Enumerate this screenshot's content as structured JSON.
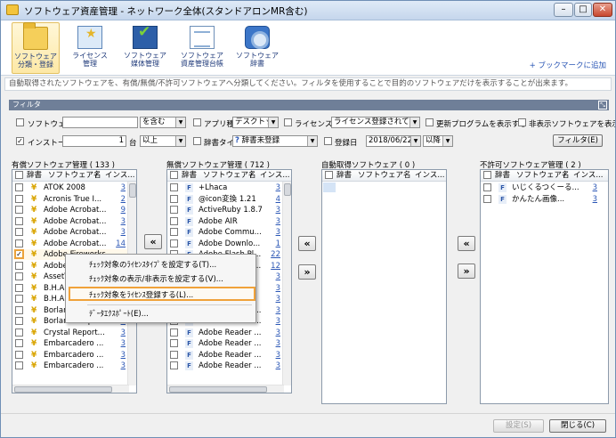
{
  "window": {
    "title": "ソフトウェア資産管理 - ネットワーク全体(スタンドアロンMR含む)",
    "controls": {
      "minimize": "–",
      "maximize": "□",
      "close": "✕"
    }
  },
  "ribbon": {
    "buttons": [
      {
        "label1": "ソフトウェア",
        "label2": "分類・登録",
        "icon": "folder-icon",
        "active": true
      },
      {
        "label1": "ライセンス",
        "label2": "管理",
        "icon": "certificate-icon"
      },
      {
        "label1": "ソフトウェア",
        "label2": "媒体管理",
        "icon": "media-check-icon"
      },
      {
        "label1": "ソフトウェア",
        "label2": "資産管理台帳",
        "icon": "ledger-icon"
      },
      {
        "label1": "ソフトウェア",
        "label2": "辞書",
        "icon": "dictionary-icon"
      }
    ],
    "bookmark": "+ ブックマークに追加"
  },
  "info_text": "自動取得されたソフトウェアを、有償/無償/不許可ソフトウェアへ分類してください。フィルタを使用することで目的のソフトウェアだけを表示することが出来ます。",
  "filter": {
    "header": "フィルタ",
    "corner": "⤡",
    "software_name": {
      "label": "ソフトウェア名",
      "value": "",
      "match": "を含む"
    },
    "app_type": {
      "label": "アプリ種別",
      "value": "デスクトップ"
    },
    "license": {
      "label": "ライセンス登録",
      "value": "ライセンス登録されていない"
    },
    "show_update": "更新プログラムを表示する",
    "show_hidden": "非表示ソフトウェアを表示する",
    "install_count": {
      "label": "インストール数",
      "value": "1",
      "unit": "台",
      "cmp": "以上"
    },
    "dict_type": {
      "label": "辞書タイプ",
      "icon": "?",
      "value": "辞書未登録"
    },
    "reg_date": {
      "label": "登録日",
      "value": "2018/06/22",
      "cmp": "以降"
    },
    "button": "フィルタ(E)"
  },
  "columns": {
    "dict": "辞書",
    "name": "ソフトウェア名",
    "sort": "/",
    "install": "インス..."
  },
  "paid": {
    "title": "有償ソフトウェア管理 ( 133 )",
    "rows": [
      {
        "name": "ATOK 2008",
        "count": "3",
        "checked": false
      },
      {
        "name": "Acronis True I...",
        "count": "2",
        "checked": false
      },
      {
        "name": "Adobe Acrobat...",
        "count": "9",
        "checked": false
      },
      {
        "name": "Adobe Acrobat...",
        "count": "3",
        "checked": false
      },
      {
        "name": "Adobe Acrobat...",
        "count": "3",
        "checked": false
      },
      {
        "name": "Adobe Acrobat...",
        "count": "14",
        "checked": false
      },
      {
        "name": "Adobe Fireworks",
        "count": "",
        "checked": true,
        "check_mark": "✓"
      },
      {
        "name": "Adobe",
        "count": "",
        "checked": false
      },
      {
        "name": "AssetV",
        "count": "",
        "checked": false
      },
      {
        "name": "B.H.A",
        "count": "",
        "checked": false
      },
      {
        "name": "B.H.A",
        "count": "",
        "checked": false
      },
      {
        "name": "Borland Delphi 5",
        "count": "",
        "checked": false
      },
      {
        "name": "Borland Delphi 6",
        "count": "5",
        "checked": false
      },
      {
        "name": "Crystal Report...",
        "count": "3",
        "checked": false
      },
      {
        "name": "Embarcadero ...",
        "count": "3",
        "checked": false
      },
      {
        "name": "Embarcadero ...",
        "count": "3",
        "checked": false
      },
      {
        "name": "Embarcadero ...",
        "count": "3",
        "checked": false
      }
    ]
  },
  "free": {
    "title": "無償ソフトウェア管理 ( 712 )",
    "rows": [
      {
        "name": "+Lhaca",
        "count": "3"
      },
      {
        "name": "@icon変換 1.21",
        "count": "4"
      },
      {
        "name": "ActiveRuby 1.8.7",
        "count": "3"
      },
      {
        "name": "Adobe AIR",
        "count": "3"
      },
      {
        "name": "Adobe Commu...",
        "count": "3"
      },
      {
        "name": "Adobe Downlo...",
        "count": "1"
      },
      {
        "name": "Adobe Flash Pl...",
        "count": "22"
      },
      {
        "name": "Adobe Flash Pl...",
        "count": "12"
      },
      {
        "name": "",
        "count": "3"
      },
      {
        "name": "",
        "count": "3"
      },
      {
        "name": "",
        "count": "3"
      },
      {
        "name": "Adobe Reader ...",
        "count": "3"
      },
      {
        "name": "Adobe Reader ...",
        "count": "3"
      },
      {
        "name": "Adobe Reader ...",
        "count": "3"
      },
      {
        "name": "Adobe Reader ...",
        "count": "3"
      },
      {
        "name": "Adobe Reader ...",
        "count": "3"
      },
      {
        "name": "Adobe Reader ...",
        "count": "3"
      }
    ]
  },
  "auto": {
    "title": "自動取得ソフトウェア ( 0 )"
  },
  "forbidden": {
    "title": "不許可ソフトウェア管理 ( 2 )",
    "rows": [
      {
        "name": "いじくるつくーる...",
        "count": "3"
      },
      {
        "name": "かんたん画像...",
        "count": "3"
      }
    ]
  },
  "move": {
    "left": "«",
    "right": "»"
  },
  "context_menu": [
    "ﾁｪｯｸ対象のﾗｲｾﾝｽﾀｲﾌﾟを設定する(T)...",
    "ﾁｪｯｸ対象の表示/非表示を設定する(V)...",
    "ﾁｪｯｸ対象をﾗｲｾﾝｽ登録する(L)...",
    "ﾃﾞｰﾀｴｸｽﾎﾟｰﾄ(E)..."
  ],
  "buttons": {
    "apply": "設定(S)",
    "close": "閉じる(C)"
  }
}
